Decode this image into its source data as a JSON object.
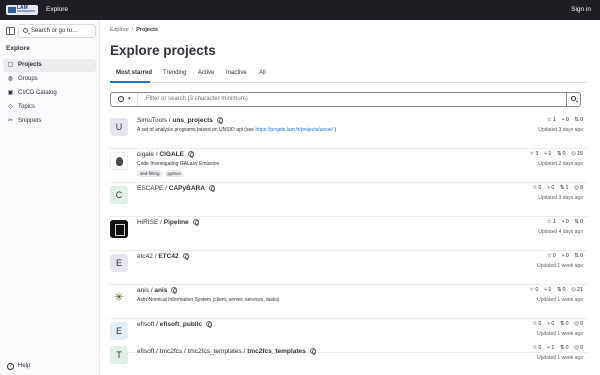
{
  "topbar": {
    "logo_text": "LAM",
    "explore": "Explore",
    "sign_in": "Sign in"
  },
  "sidebar": {
    "search_label": "Search or go to…",
    "heading": "Explore",
    "items": [
      {
        "label": "Projects",
        "icon": "project-icon",
        "active": true
      },
      {
        "label": "Groups",
        "icon": "group-icon",
        "active": false
      },
      {
        "label": "CI/CD Catalog",
        "icon": "catalog-icon",
        "active": false
      },
      {
        "label": "Topics",
        "icon": "topic-icon",
        "active": false
      },
      {
        "label": "Snippets",
        "icon": "snippet-icon",
        "active": false
      }
    ],
    "help": "Help"
  },
  "breadcrumb": {
    "parent": "Explore",
    "current": "Projects"
  },
  "page_title": "Explore projects",
  "tabs": [
    "Most starred",
    "Trending",
    "Active",
    "Inactive",
    "All"
  ],
  "filter": {
    "placeholder": "Filter or search (3 character minimum)"
  },
  "projects": [
    {
      "namespace": "SimuTools / ",
      "name": "uns_projects",
      "avatar": "U",
      "avatar_bg": "#e7e4f2",
      "desc": "A set of analysis programs based on UNSIO api (see ",
      "desc_link": "https://projets.lam.fr/projects/unsio/",
      "desc_end": " )",
      "stars": "1",
      "forks": "0",
      "mrs": "0",
      "issues": "",
      "updated": "Updated 3 days ago"
    },
    {
      "namespace": "cigale / ",
      "name": "CIGALE",
      "avatar": "",
      "avatar_bg": "",
      "desc": "Code Investigating GALaxy Emission",
      "desc_link": "",
      "desc_end": "",
      "tags": [
        "sed-fitting",
        "python"
      ],
      "stars": "3",
      "forks": "1",
      "mrs": "0",
      "issues": "15",
      "updated": "Updated 2 days ago"
    },
    {
      "namespace": "ESCAPE / ",
      "name": "CAPyBARA",
      "avatar": "C",
      "avatar_bg": "#e1f0e6",
      "desc": "",
      "desc_link": "",
      "desc_end": "",
      "stars": "0",
      "forks": "0",
      "mrs": "1",
      "issues": "8",
      "updated": "Updated 3 days ago"
    },
    {
      "namespace": "HiRISE / ",
      "name": "Pipeline",
      "avatar": "",
      "avatar_bg": "",
      "desc": "",
      "desc_link": "",
      "desc_end": "",
      "stars": "1",
      "forks": "0",
      "mrs": "0",
      "issues": "",
      "updated": "Updated 4 days ago"
    },
    {
      "namespace": "etc42 / ",
      "name": "ETC42",
      "avatar": "E",
      "avatar_bg": "#e7e4f2",
      "desc": "",
      "desc_link": "",
      "desc_end": "",
      "stars": "0",
      "forks": "0",
      "mrs": "0",
      "issues": "",
      "updated": "Updated 1 week ago"
    },
    {
      "namespace": "anis / ",
      "name": "anis",
      "avatar": "",
      "avatar_bg": "",
      "desc": "AstroNomical Information System (client, server, services, tasks)",
      "desc_link": "",
      "desc_end": "",
      "stars": "0",
      "forks": "1",
      "mrs": "0",
      "issues": "21",
      "updated": "Updated 1 week ago"
    },
    {
      "namespace": "efisoft / ",
      "name": "efisoft_public",
      "avatar": "E",
      "avatar_bg": "#e4eef9",
      "desc": "",
      "desc_link": "",
      "desc_end": "",
      "stars": "0",
      "forks": "0",
      "mrs": "0",
      "issues": "0",
      "updated": "Updated 1 week ago"
    },
    {
      "namespace": "efisoft / tmc2fcs / tmc2fcs_templates / ",
      "name": "tmc2fcs_templates",
      "avatar": "T",
      "avatar_bg": "#e1f0e6",
      "desc": "",
      "desc_link": "",
      "desc_end": "",
      "stars": "0",
      "forks": "1",
      "mrs": "0",
      "issues": "0",
      "updated": "Updated 1 week ago"
    }
  ]
}
